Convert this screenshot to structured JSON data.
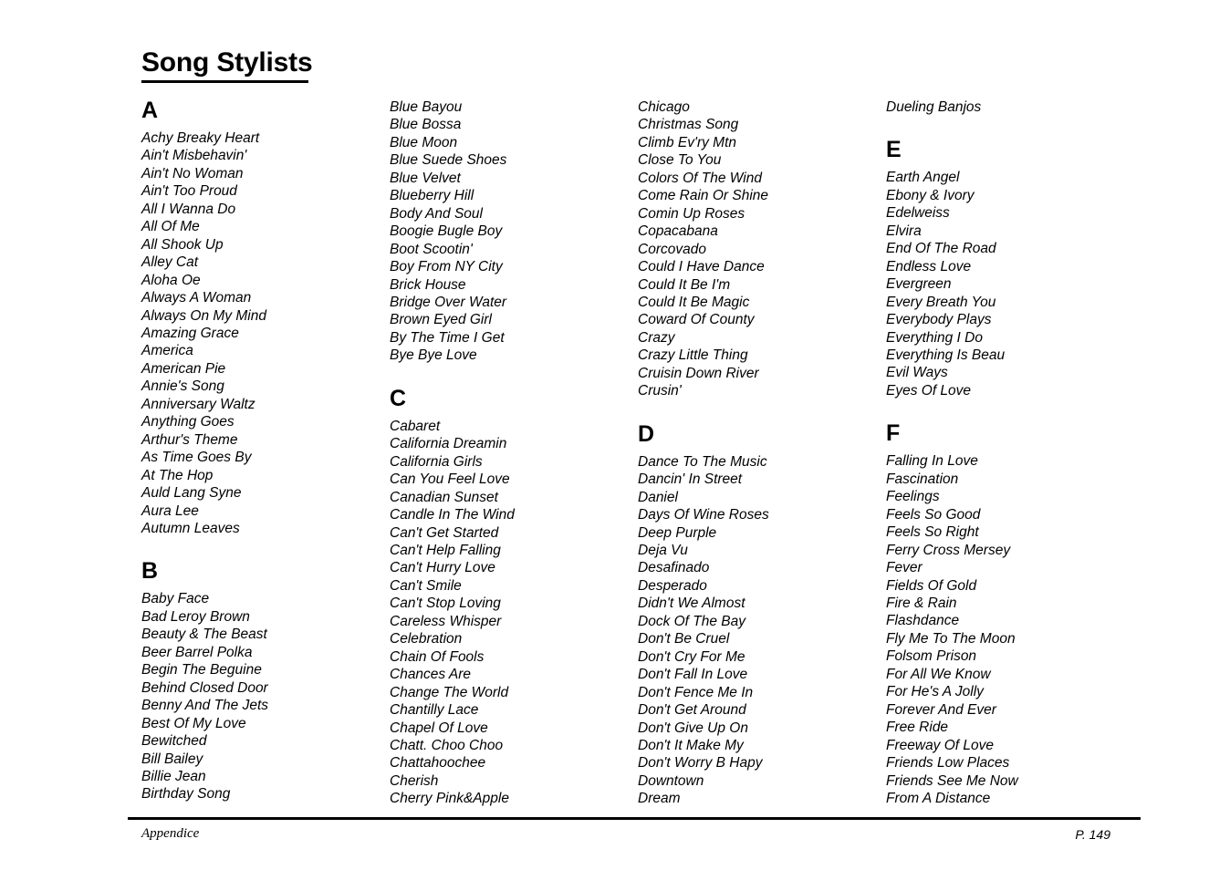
{
  "document": {
    "title": "Song Stylists"
  },
  "footer": {
    "left_label": "Appendice",
    "page_label": "P. 149"
  },
  "columns": [
    {
      "blocks": [
        {
          "heading": "A",
          "songs": [
            "Achy Breaky Heart",
            "Ain't Misbehavin'",
            "Ain't No Woman",
            "Ain't Too Proud",
            "All I Wanna Do",
            "All Of Me",
            "All Shook Up",
            "Alley Cat",
            "Aloha Oe",
            "Always A Woman",
            "Always On My Mind",
            "Amazing Grace",
            "America",
            "American Pie",
            "Annie's Song",
            "Anniversary Waltz",
            "Anything Goes",
            "Arthur's Theme",
            "As Time Goes By",
            "At The Hop",
            "Auld Lang Syne",
            "Aura Lee",
            "Autumn Leaves"
          ]
        },
        {
          "heading": "B",
          "songs": [
            "Baby Face",
            "Bad Leroy Brown",
            "Beauty & The Beast",
            "Beer Barrel Polka",
            "Begin The Beguine",
            "Behind Closed Door",
            "Benny And The Jets",
            "Best Of My Love",
            "Bewitched",
            "Bill Bailey",
            "Billie Jean",
            "Birthday Song"
          ]
        }
      ]
    },
    {
      "blocks": [
        {
          "heading": "",
          "songs": [
            "Blue Bayou",
            "Blue Bossa",
            "Blue Moon",
            "Blue Suede Shoes",
            "Blue Velvet",
            "Blueberry Hill",
            "Body And Soul",
            "Boogie Bugle Boy",
            "Boot Scootin'",
            "Boy From NY City",
            "Brick House",
            "Bridge Over Water",
            "Brown Eyed Girl",
            "By The Time I Get",
            "Bye Bye Love"
          ]
        },
        {
          "heading": "C",
          "songs": [
            "Cabaret",
            "California Dreamin",
            "California Girls",
            "Can You Feel Love",
            "Canadian Sunset",
            "Candle In The Wind",
            "Can't Get Started",
            "Can't Help Falling",
            "Can't Hurry Love",
            "Can't Smile",
            "Can't Stop Loving",
            "Careless Whisper",
            "Celebration",
            "Chain Of Fools",
            "Chances Are",
            "Change The World",
            "Chantilly Lace",
            "Chapel Of Love",
            "Chatt. Choo Choo",
            "Chattahoochee",
            "Cherish",
            "Cherry Pink&Apple"
          ]
        }
      ]
    },
    {
      "blocks": [
        {
          "heading": "",
          "songs": [
            "Chicago",
            "Christmas Song",
            "Climb Ev'ry Mtn",
            "Close To You",
            "Colors Of The Wind",
            "Come Rain Or Shine",
            "Comin Up Roses",
            "Copacabana",
            "Corcovado",
            "Could I Have Dance",
            "Could It Be I'm",
            "Could It Be Magic",
            "Coward Of County",
            "Crazy",
            "Crazy Little Thing",
            "Cruisin Down River",
            "Crusin'"
          ]
        },
        {
          "heading": "D",
          "songs": [
            "Dance To The Music",
            "Dancin' In Street",
            "Daniel",
            "Days Of Wine Roses",
            "Deep Purple",
            "Deja Vu",
            "Desafinado",
            "Desperado",
            "Didn't We Almost",
            "Dock Of The Bay",
            "Don't Be Cruel",
            "Don't Cry For Me",
            "Don't Fall In Love",
            "Don't Fence Me In",
            "Don't Get Around",
            "Don't Give Up On",
            "Don't It Make My",
            "Don't Worry B Hapy",
            "Downtown",
            "Dream"
          ]
        }
      ]
    },
    {
      "blocks": [
        {
          "heading": "",
          "songs": [
            "Dueling Banjos"
          ]
        },
        {
          "heading": "E",
          "songs": [
            "Earth Angel",
            "Ebony & Ivory",
            "Edelweiss",
            "Elvira",
            "End Of The Road",
            "Endless Love",
            "Evergreen",
            "Every Breath You",
            "Everybody Plays",
            "Everything I Do",
            "Everything Is Beau",
            "Evil Ways",
            "Eyes Of Love"
          ]
        },
        {
          "heading": "F",
          "songs": [
            "Falling In Love",
            "Fascination",
            "Feelings",
            "Feels So Good",
            "Feels So Right",
            "Ferry Cross Mersey",
            "Fever",
            "Fields Of Gold",
            "Fire & Rain",
            "Flashdance",
            "Fly Me To The Moon",
            "Folsom Prison",
            "For All We Know",
            "For He's A Jolly",
            "Forever And Ever",
            "Free Ride",
            "Freeway Of Love",
            "Friends Low Places",
            "Friends See Me Now",
            "From A Distance"
          ]
        }
      ]
    }
  ]
}
